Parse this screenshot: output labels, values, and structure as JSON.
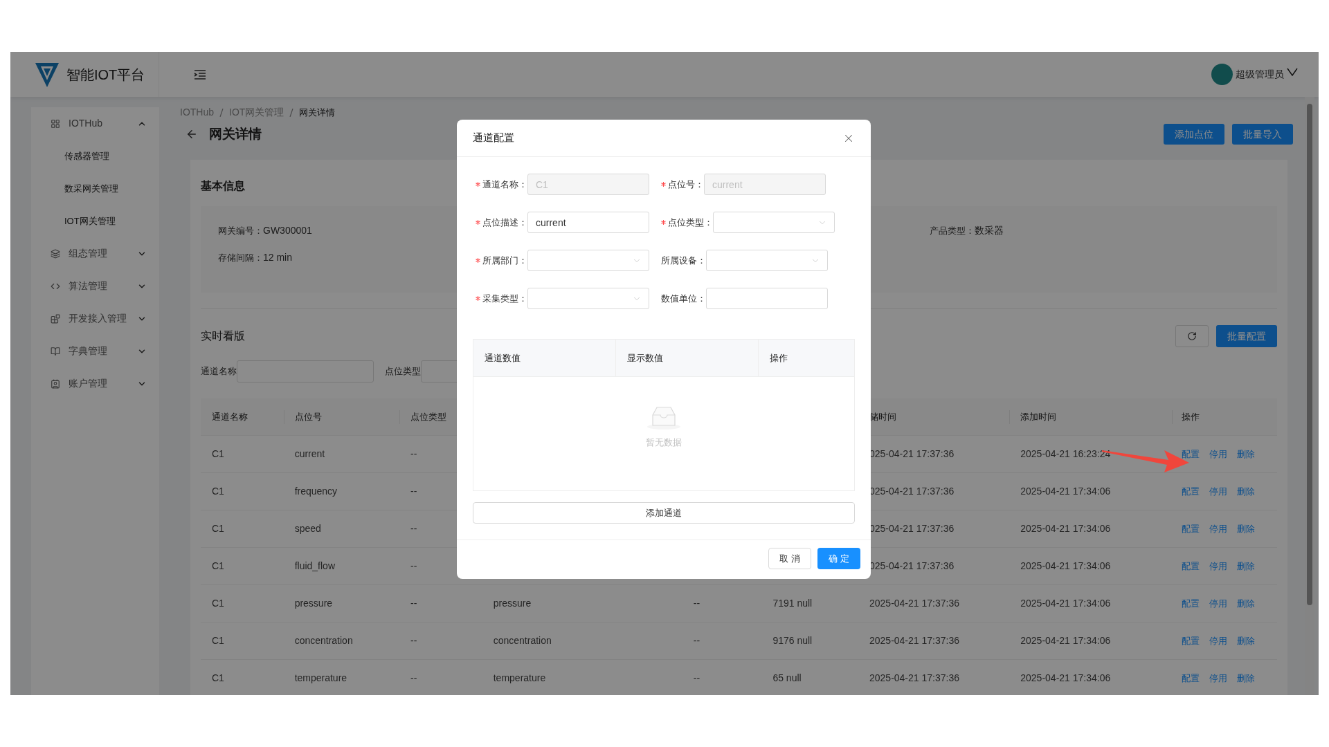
{
  "header": {
    "app_title": "智能IOT平台",
    "user_name": "超级管理员"
  },
  "sidebar": {
    "items": [
      {
        "label": "IOTHub",
        "expanded": true,
        "children": [
          {
            "label": "传感器管理"
          },
          {
            "label": "数采网关管理"
          },
          {
            "label": "IOT网关管理"
          }
        ]
      },
      {
        "label": "组态管理",
        "expanded": false
      },
      {
        "label": "算法管理",
        "expanded": false
      },
      {
        "label": "开发接入管理",
        "expanded": false
      },
      {
        "label": "字典管理",
        "expanded": false
      },
      {
        "label": "账户管理",
        "expanded": false
      }
    ]
  },
  "breadcrumb": [
    "IOTHub",
    "IOT网关管理",
    "网关详情"
  ],
  "page_title": "网关详情",
  "page_actions": [
    "添加点位",
    "批量导入"
  ],
  "basic_info": {
    "title": "基本信息",
    "fields": [
      {
        "label": "网关编号：",
        "value": "GW300001"
      },
      {
        "label": "存储间隔：",
        "value": "12 min"
      },
      {
        "label": "产品类型：",
        "value": "数采器"
      }
    ]
  },
  "realtime": {
    "title": "实时看版",
    "batch_button": "批量配置",
    "filters": [
      {
        "label": "通道名称"
      },
      {
        "label": "点位类型"
      }
    ]
  },
  "table": {
    "columns": [
      {
        "label": "通道名称"
      },
      {
        "label": "点位号"
      },
      {
        "label": "点位类型"
      },
      {},
      {},
      {},
      {
        "label": "储时间"
      },
      {
        "label": "添加时间"
      },
      {
        "label": "操作"
      }
    ],
    "rows": [
      {
        "channel_name": "C1",
        "point_no": "current",
        "point_type": "--",
        "storage_time": "025-04-21 17:37:36",
        "add_time": "2025-04-21 16:23:24",
        "actions": [
          "配置",
          "停用",
          "删除"
        ]
      },
      {
        "channel_name": "C1",
        "point_no": "frequency",
        "point_type": "--",
        "storage_time": "025-04-21 17:37:36",
        "add_time": "2025-04-21 17:34:06",
        "actions": [
          "配置",
          "停用",
          "删除"
        ]
      },
      {
        "channel_name": "C1",
        "point_no": "speed",
        "point_type": "--",
        "storage_time": "025-04-21 17:37:36",
        "add_time": "2025-04-21 17:34:06",
        "actions": [
          "配置",
          "停用",
          "删除"
        ]
      },
      {
        "channel_name": "C1",
        "point_no": "fluid_flow",
        "point_type": "--",
        "storage_time": "025-04-21 17:37:36",
        "add_time": "2025-04-21 17:34:06",
        "actions": [
          "配置",
          "停用",
          "删除"
        ]
      },
      {
        "channel_name": "C1",
        "point_no": "pressure",
        "point_type": "--",
        "column_4": "pressure",
        "column_5": "--",
        "column_6": "7191 null",
        "storage_time": "2025-04-21 17:37:36",
        "add_time": "2025-04-21 17:34:06",
        "actions": [
          "配置",
          "停用",
          "删除"
        ]
      },
      {
        "channel_name": "C1",
        "point_no": "concentration",
        "point_type": "--",
        "column_4": "concentration",
        "column_5": "--",
        "column_6": "9176 null",
        "storage_time": "2025-04-21 17:37:36",
        "add_time": "2025-04-21 17:34:06",
        "actions": [
          "配置",
          "停用",
          "删除"
        ]
      },
      {
        "channel_name": "C1",
        "point_no": "temperature",
        "point_type": "--",
        "column_4": "temperature",
        "column_5": "--",
        "column_6": "65 null",
        "storage_time": "2025-04-21 17:37:36",
        "add_time": "2025-04-21 17:34:06",
        "actions": [
          "配置",
          "停用",
          "删除"
        ]
      }
    ]
  },
  "dialog": {
    "title": "通道配置",
    "fields": [
      {
        "label": "通道名称：",
        "required": true,
        "kind": "input",
        "value": "C1",
        "disabled": true
      },
      {
        "label": "点位号：",
        "required": true,
        "kind": "input",
        "value": "current",
        "disabled": true
      },
      {
        "label": "点位描述：",
        "required": true,
        "kind": "input",
        "value": "current",
        "disabled": false
      },
      {
        "label": "点位类型：",
        "required": true,
        "kind": "select"
      },
      {
        "label": "所属部门：",
        "required": true,
        "kind": "select"
      },
      {
        "label": "所属设备：",
        "required": false,
        "kind": "select"
      },
      {
        "label": "采集类型：",
        "required": true,
        "kind": "select"
      },
      {
        "label": "数值单位：",
        "required": false,
        "kind": "input"
      }
    ],
    "inner_table": {
      "columns": [
        "通道数值",
        "显示数值",
        "操作"
      ],
      "empty_text": "暂无数据"
    },
    "add_button": "添加通道",
    "cancel_button": "取 消",
    "ok_button": "确 定"
  }
}
